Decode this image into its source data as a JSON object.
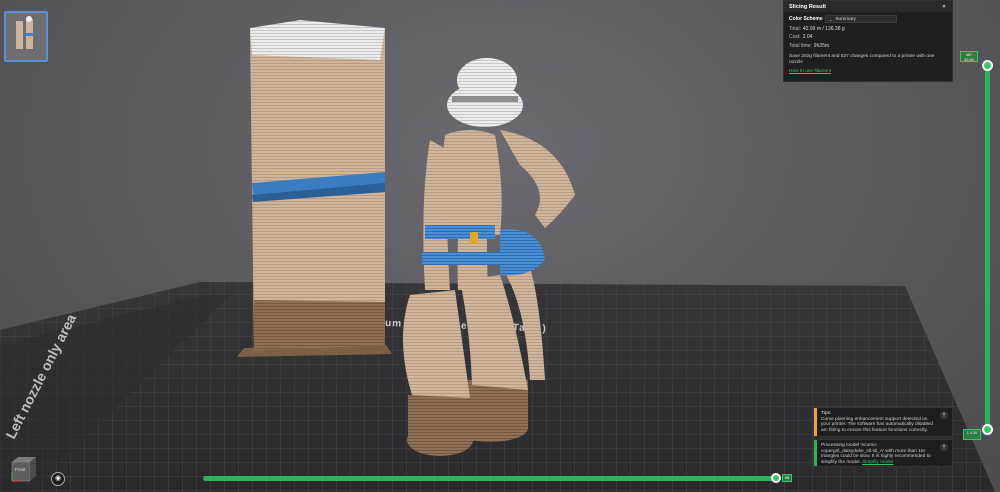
{
  "bed": {
    "left_area_label": "Left nozzle only area",
    "plate_label": "um        ate ( SuperTack )"
  },
  "result_panel": {
    "title": "Slicing Result",
    "color_scheme_label": "Color Scheme",
    "color_scheme_value": "Summary",
    "total_label": "Total:",
    "total_value": "42.99 m / 136.38 g",
    "cost_label": "Cost:",
    "cost_value": "2.04",
    "time_label": "Total time:",
    "time_value": "9h25m",
    "note": "Save 202g filament and 537 changes compared to a printer with one nozzle",
    "link": "How to use filament"
  },
  "notices": [
    {
      "title": "Tips:",
      "body": "Curve planning enhancement support detected on your printer. The software has automatically disabled arc fitting to ensure this feature functions correctly.",
      "color": "#f0a33c"
    },
    {
      "body": "Processing model 'ecomo-copergirl_daisyduke_stl.stl_A' with more than 1M triangles could be slow. It is highly recommended to simplify the model.",
      "link": "Simplify model",
      "color": "#2fb35a"
    }
  ],
  "slider": {
    "top_label": "487\n52.45",
    "bottom_label": "1\n0.20",
    "h_label": "65"
  },
  "view_cube": {
    "label": "Front"
  },
  "colors": {
    "accent": "#2fb35a",
    "wood_light": "#cdb39a",
    "wood_dark": "#8a6c52",
    "blue_band": "#2f78b8",
    "shorts_blue": "#3d83c9",
    "white_hat": "#e6e6e6"
  }
}
